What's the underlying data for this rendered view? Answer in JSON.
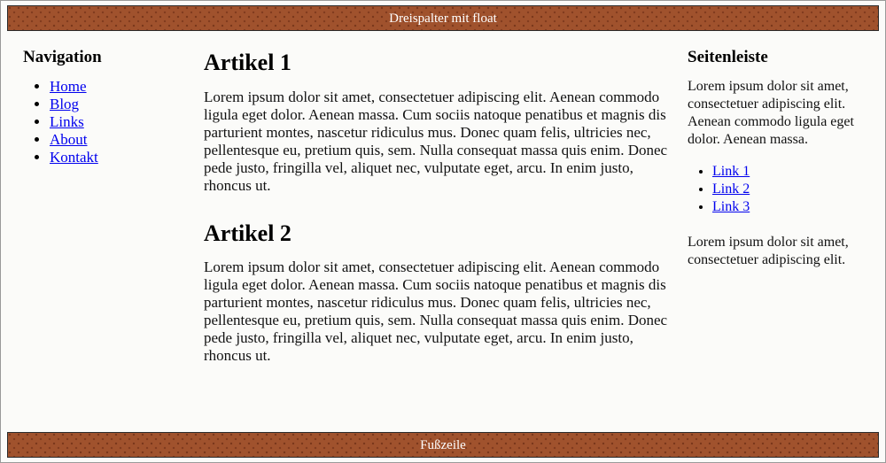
{
  "header": {
    "title": "Dreispalter mit float"
  },
  "footer": {
    "title": "Fußzeile"
  },
  "colors": {
    "band_background": "#a0522d",
    "band_text": "#ffffff",
    "page_background": "#fbfbf9",
    "link": "#0000ee",
    "text": "#111111",
    "border": "#2b2b2b"
  },
  "nav": {
    "heading": "Navigation",
    "items": [
      {
        "label": "Home"
      },
      {
        "label": "Blog"
      },
      {
        "label": "Links"
      },
      {
        "label": "About"
      },
      {
        "label": "Kontakt"
      }
    ]
  },
  "content": {
    "articles": [
      {
        "title": "Artikel 1",
        "body": "Lorem ipsum dolor sit amet, consectetuer adipiscing elit. Aenean commodo ligula eget dolor. Aenean massa. Cum sociis natoque penatibus et magnis dis parturient montes, nascetur ridiculus mus. Donec quam felis, ultricies nec, pellentesque eu, pretium quis, sem. Nulla consequat massa quis enim. Donec pede justo, fringilla vel, aliquet nec, vulputate eget, arcu. In enim justo, rhoncus ut."
      },
      {
        "title": "Artikel 2",
        "body": "Lorem ipsum dolor sit amet, consectetuer adipiscing elit. Aenean commodo ligula eget dolor. Aenean massa. Cum sociis natoque penatibus et magnis dis parturient montes, nascetur ridiculus mus. Donec quam felis, ultricies nec, pellentesque eu, pretium quis, sem. Nulla consequat massa quis enim. Donec pede justo, fringilla vel, aliquet nec, vulputate eget, arcu. In enim justo, rhoncus ut."
      }
    ]
  },
  "sidebar": {
    "heading": "Seitenleiste",
    "intro": "Lorem ipsum dolor sit amet, consectetuer adipiscing elit. Aenean commodo ligula eget dolor. Aenean massa.",
    "links": [
      {
        "label": "Link 1"
      },
      {
        "label": "Link 2"
      },
      {
        "label": "Link 3"
      }
    ],
    "outro": "Lorem ipsum dolor sit amet, consectetuer adipiscing elit."
  }
}
